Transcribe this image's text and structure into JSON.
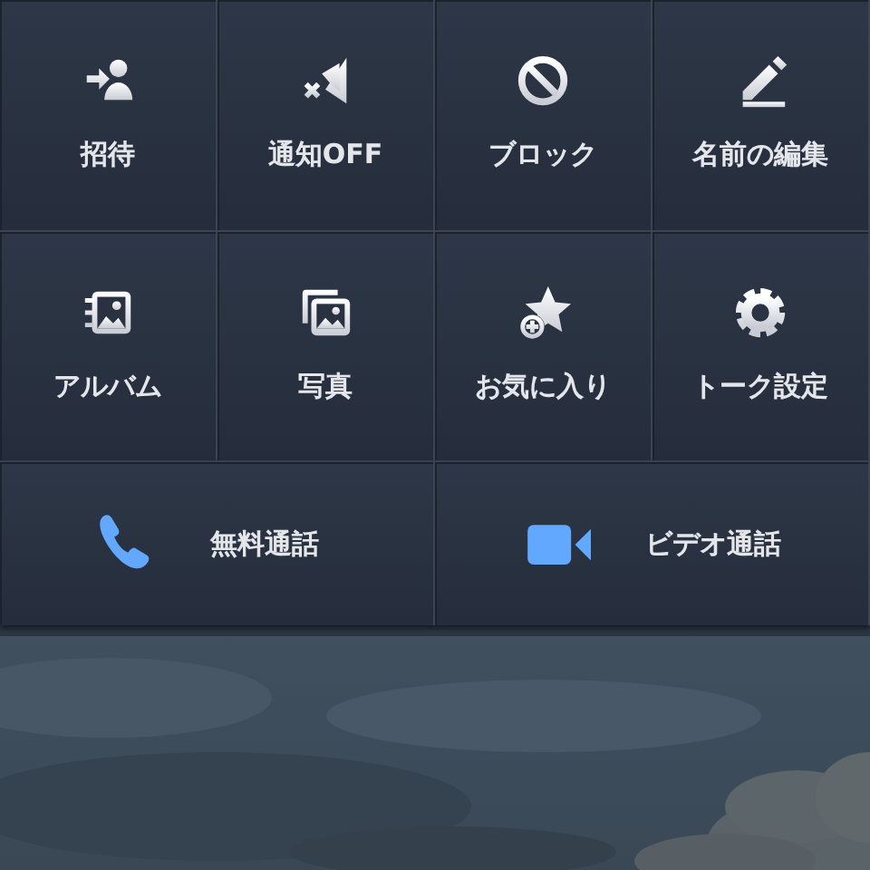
{
  "menu": {
    "tiles": [
      {
        "kind": "invite",
        "label": "招待"
      },
      {
        "kind": "mute",
        "label": "通知OFF"
      },
      {
        "kind": "block",
        "label": "ブロック"
      },
      {
        "kind": "edit",
        "label": "名前の編集"
      },
      {
        "kind": "album",
        "label": "アルバム"
      },
      {
        "kind": "photos",
        "label": "写真"
      },
      {
        "kind": "favorite",
        "label": "お気に入り"
      },
      {
        "kind": "settings",
        "label": "トーク設定"
      }
    ],
    "calls": [
      {
        "kind": "voice",
        "label": "無料通話"
      },
      {
        "kind": "video",
        "label": "ビデオ通話"
      }
    ]
  }
}
